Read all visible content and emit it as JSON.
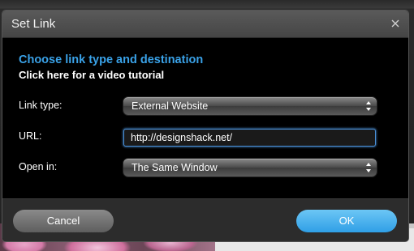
{
  "dialog": {
    "title": "Set Link",
    "close_icon": "close-icon",
    "heading": "Choose link type and destination",
    "tutorial_link": "Click here for a video tutorial",
    "fields": {
      "link_type": {
        "label": "Link type:",
        "value": "External Website"
      },
      "url": {
        "label": "URL:",
        "value": "http://designshack.net/"
      },
      "open_in": {
        "label": "Open in:",
        "value": "The Same Window"
      }
    },
    "buttons": {
      "cancel": "Cancel",
      "ok": "OK"
    }
  },
  "colors": {
    "heading": "#3aa2e8",
    "ok_button": "#2f9fe6",
    "cancel_button": "#6e6e6e"
  }
}
